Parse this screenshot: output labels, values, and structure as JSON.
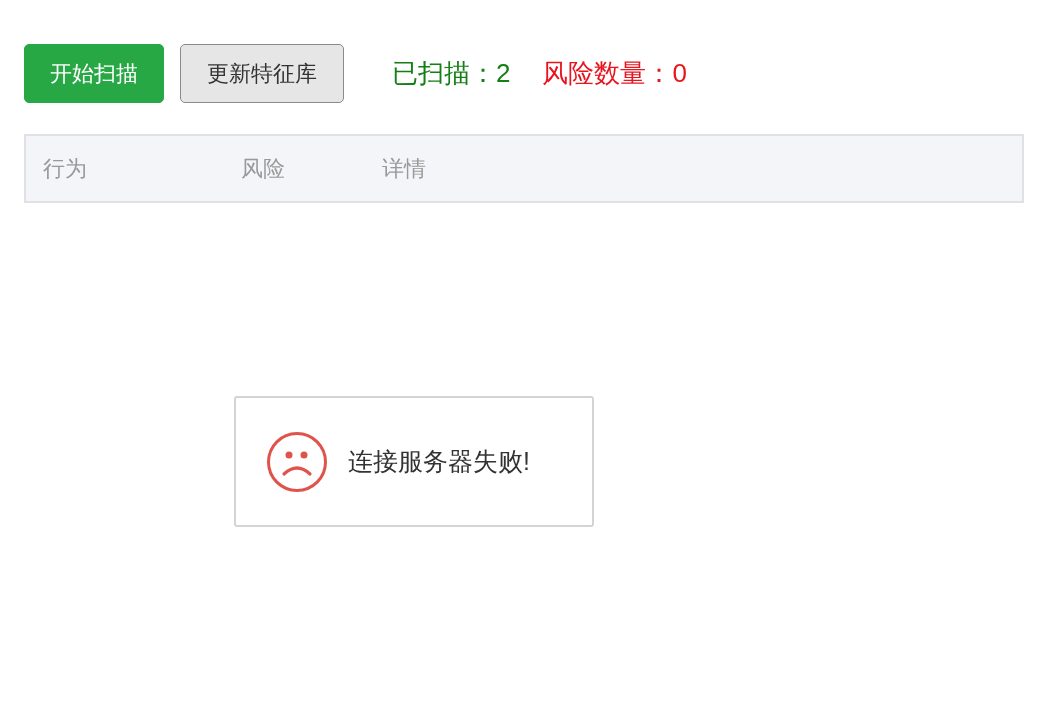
{
  "toolbar": {
    "buttons": [
      {
        "label": "开始扫描",
        "kind": "primary"
      },
      {
        "label": "更新特征库",
        "kind": "default"
      }
    ],
    "stats": [
      {
        "text": "已扫描：2",
        "kind": "ok"
      },
      {
        "text": "风险数量：0",
        "kind": "danger"
      }
    ]
  },
  "table": {
    "columns": [
      "行为",
      "风险",
      "详情"
    ]
  },
  "toast": {
    "kind": "error",
    "message": "连接服务器失败!"
  }
}
